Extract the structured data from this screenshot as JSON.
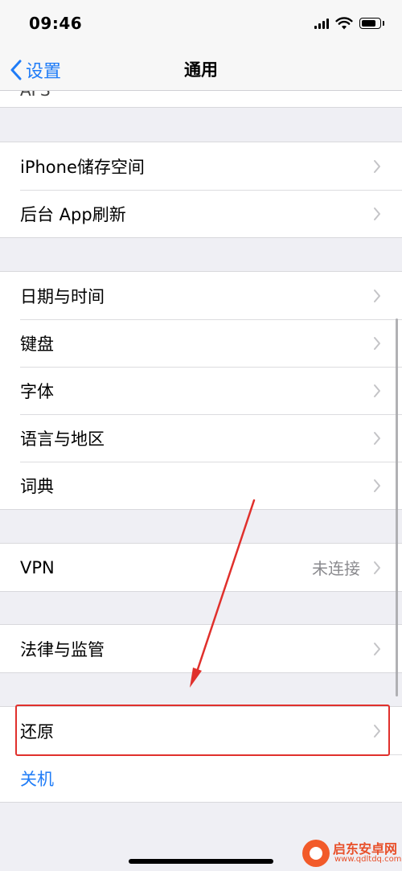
{
  "status_bar": {
    "time": "09:46"
  },
  "nav": {
    "back_label": "设置",
    "title": "通用"
  },
  "cut_row_label": "AFS",
  "groups": [
    {
      "rows": [
        {
          "label": "iPhone储存空间"
        },
        {
          "label": "后台 App刷新"
        }
      ]
    },
    {
      "rows": [
        {
          "label": "日期与时间"
        },
        {
          "label": "键盘"
        },
        {
          "label": "字体"
        },
        {
          "label": "语言与地区"
        },
        {
          "label": "词典"
        }
      ]
    },
    {
      "rows": [
        {
          "label": "VPN",
          "detail": "未连接"
        }
      ]
    },
    {
      "rows": [
        {
          "label": "法律与监管"
        }
      ]
    },
    {
      "rows": [
        {
          "label": "还原"
        },
        {
          "label": "关机"
        }
      ]
    }
  ],
  "colors": {
    "accent": "#1f7cf7",
    "annotation": "#e0302c",
    "background": "#efeff4"
  },
  "watermark": {
    "title": "启东安卓网",
    "url": "www.qdltdq.com"
  }
}
